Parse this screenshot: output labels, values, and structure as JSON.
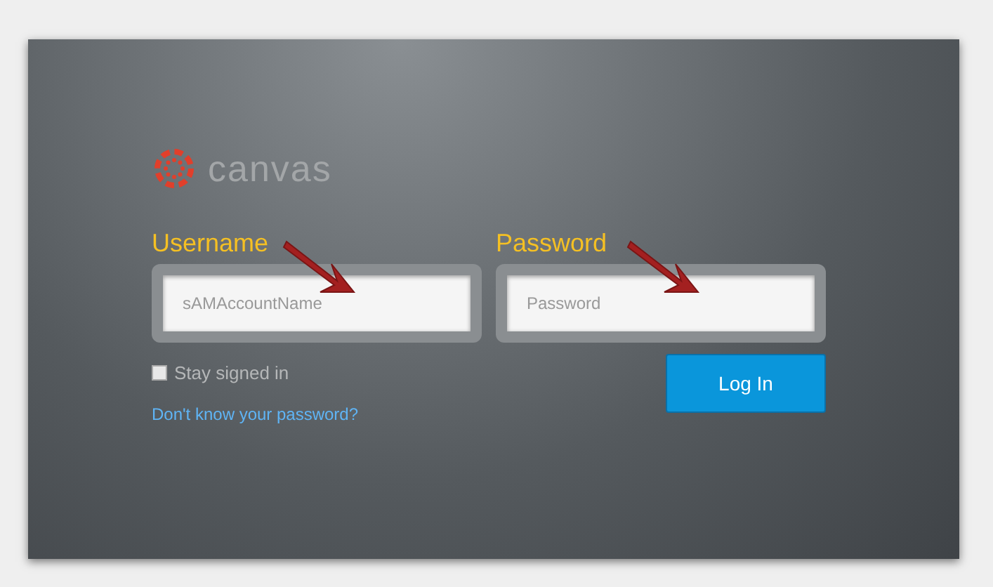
{
  "logo": {
    "text": "canvas"
  },
  "fields": [
    {
      "label": "Username",
      "placeholder": "sAMAccountName"
    },
    {
      "label": "Password",
      "placeholder": "Password"
    }
  ],
  "stay_signed_in": {
    "label": "Stay signed in",
    "checked": false
  },
  "forgot_link": "Don't know your password?",
  "login_button": "Log In"
}
